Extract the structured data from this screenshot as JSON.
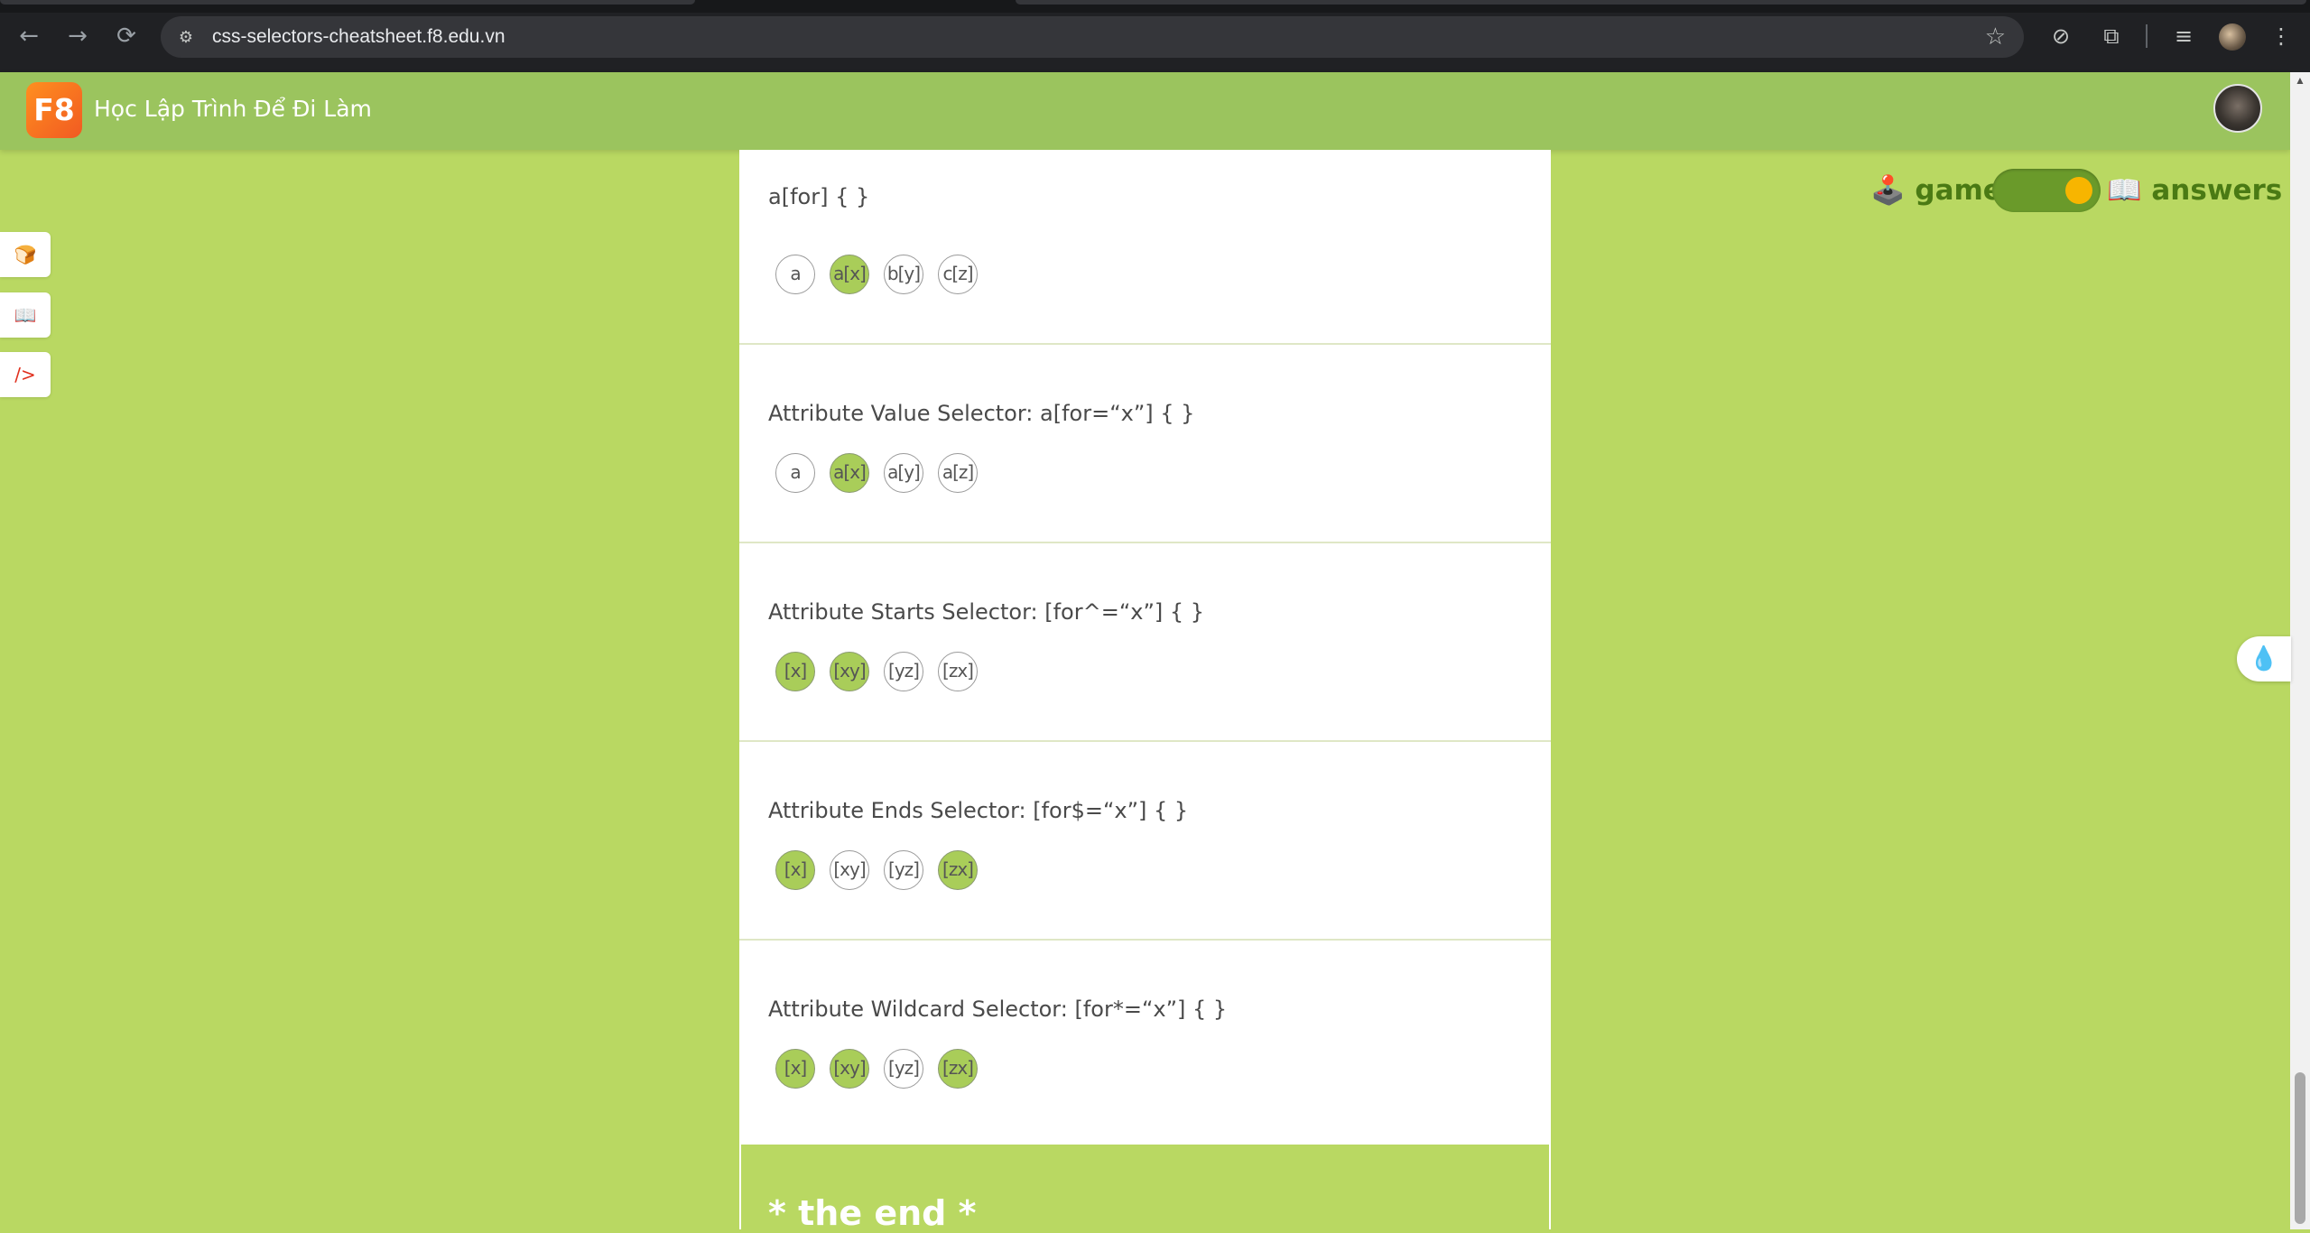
{
  "browser": {
    "url": "css-selectors-cheatsheet.f8.edu.vn",
    "icons": {
      "back": "arrow-left-icon",
      "forward": "arrow-right-icon",
      "reload": "reload-icon",
      "site_info": "tune-icon",
      "bookmark": "star-icon",
      "extension1": "compass-icon",
      "extensions": "puzzle-icon",
      "media": "media-queue-icon",
      "menu": "kebab-menu-icon"
    }
  },
  "header": {
    "logo_text": "F8",
    "title": "Học Lập Trình Để Đi Làm"
  },
  "sidebar": {
    "buttons": [
      {
        "icon": "🍞"
      },
      {
        "icon": "📖"
      },
      {
        "icon": "/>"
      }
    ]
  },
  "mode_toggle": {
    "left_label": "🕹️ game",
    "right_label": "📖 answers",
    "state": "answers",
    "knob_color": "#f7b500"
  },
  "cards": [
    {
      "title": "a[for] { }",
      "chips": [
        {
          "label": "a",
          "active": false
        },
        {
          "label": "a[x]",
          "active": true
        },
        {
          "label": "b[y]",
          "active": false
        },
        {
          "label": "c[z]",
          "active": false
        }
      ]
    },
    {
      "title": "Attribute Value Selector: a[for=“x”] { }",
      "chips": [
        {
          "label": "a",
          "active": false
        },
        {
          "label": "a[x]",
          "active": true
        },
        {
          "label": "a[y]",
          "active": false
        },
        {
          "label": "a[z]",
          "active": false
        }
      ]
    },
    {
      "title": "Attribute Starts Selector: [for^=“x”] { }",
      "chips": [
        {
          "label": "[x]",
          "active": true
        },
        {
          "label": "[xy]",
          "active": true
        },
        {
          "label": "[yz]",
          "active": false
        },
        {
          "label": "[zx]",
          "active": false
        }
      ]
    },
    {
      "title": "Attribute Ends Selector: [for$=“x”] { }",
      "chips": [
        {
          "label": "[x]",
          "active": true
        },
        {
          "label": "[xy]",
          "active": false
        },
        {
          "label": "[yz]",
          "active": false
        },
        {
          "label": "[zx]",
          "active": true
        }
      ]
    },
    {
      "title": "Attribute Wildcard Selector: [for*=“x”] { }",
      "chips": [
        {
          "label": "[x]",
          "active": true
        },
        {
          "label": "[xy]",
          "active": true
        },
        {
          "label": "[yz]",
          "active": false
        },
        {
          "label": "[zx]",
          "active": true
        }
      ]
    }
  ],
  "footer_card": {
    "text": "* the end *"
  },
  "floating_right": {
    "icon": "water-drop-sparkle-icon"
  },
  "colors": {
    "page_bg": "#b9d862",
    "header_bg": "#9bc45e",
    "chip_active": "#a9cd59",
    "toggle_track": "#6a9a2a"
  }
}
